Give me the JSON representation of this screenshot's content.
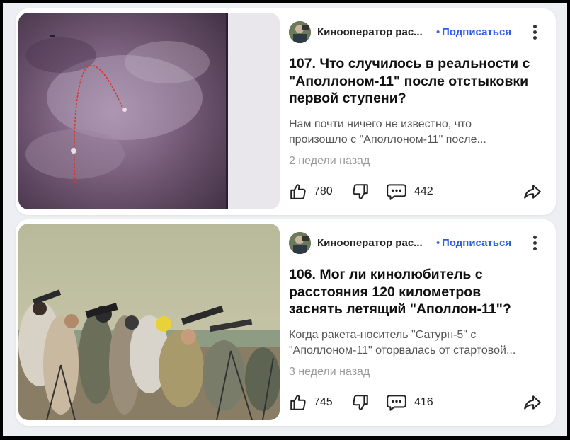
{
  "feed": [
    {
      "author": "Кинооператор рас...",
      "separator": "•",
      "subscribe_label": "Подписаться",
      "title": "107. Что случилось в реальности с \"Аполлоном-11\" после отстыковки первой ступени?",
      "snippet": "Нам почти ничего не известно, что произошло с \"Аполлоном-11\" после...",
      "time": "2 недели назад",
      "likes": "780",
      "comments": "442",
      "icons": [
        "more-icon",
        "like-icon",
        "dislike-icon",
        "comment-icon",
        "share-icon"
      ]
    },
    {
      "author": "Кинооператор рас...",
      "separator": "•",
      "subscribe_label": "Подписаться",
      "title": "106. Мог ли кинолюбитель с расстояния 120 километров заснять летящий \"Аполлон-11\"?",
      "snippet": "Когда ракета-носитель \"Сатурн-5\" с \"Аполлоном-11\" оторвалась от стартовой...",
      "time": "3 недели назад",
      "likes": "745",
      "comments": "416",
      "icons": [
        "more-icon",
        "like-icon",
        "dislike-icon",
        "comment-icon",
        "share-icon"
      ]
    }
  ],
  "colors": {
    "page_bg": "#eeeff2",
    "card_bg": "#ffffff",
    "subscribe": "#2a5fe0",
    "muted": "#999999"
  }
}
